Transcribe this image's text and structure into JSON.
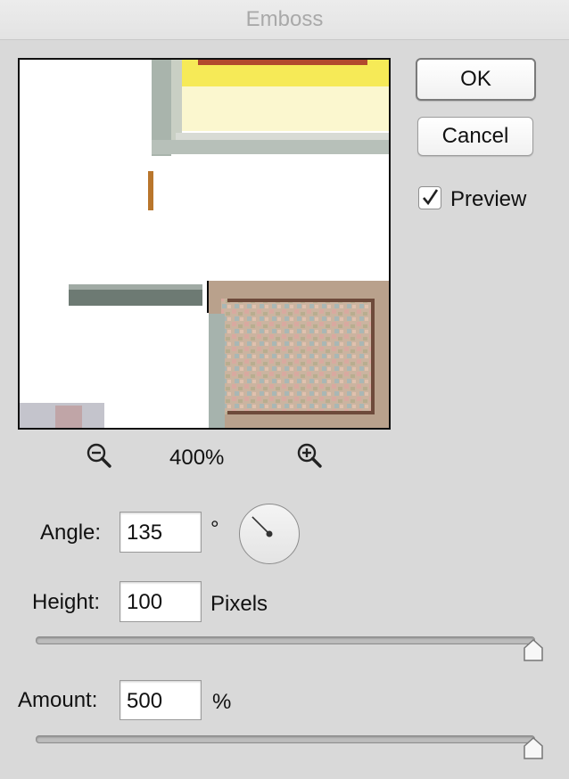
{
  "window": {
    "title": "Emboss"
  },
  "buttons": {
    "ok": "OK",
    "cancel": "Cancel"
  },
  "preview_toggle": {
    "label": "Preview",
    "checked": true
  },
  "zoom": {
    "value": "400%"
  },
  "angle": {
    "label": "Angle:",
    "value": "135",
    "unit": "°",
    "degrees": 135
  },
  "height": {
    "label": "Height:",
    "value": "100",
    "unit": "Pixels",
    "slider_fraction": 1.0
  },
  "amount": {
    "label": "Amount:",
    "value": "500",
    "unit": "%",
    "slider_fraction": 1.0
  },
  "icons": {
    "zoom_out": "zoom-out-icon",
    "zoom_in": "zoom-in-icon",
    "checkmark": "checkmark-icon"
  }
}
